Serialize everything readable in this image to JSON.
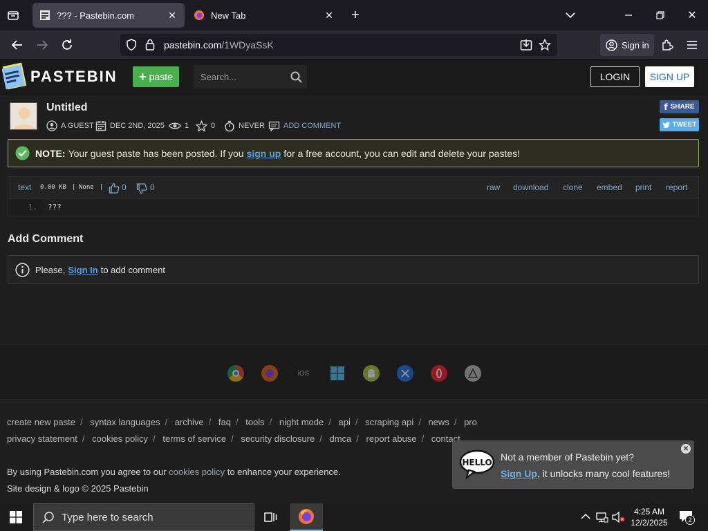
{
  "browser": {
    "tabs": [
      {
        "title": "??? - Pastebin.com",
        "active": true
      },
      {
        "title": "New Tab",
        "active": false
      }
    ],
    "url_domain": "pastebin.com",
    "url_path": "/1WDyaSsK",
    "signin_label": "Sign in"
  },
  "header": {
    "logo_text": "PASTEBIN",
    "paste_label": "paste",
    "search_placeholder": "Search...",
    "login_label": "LOGIN",
    "signup_label": "SIGN UP"
  },
  "paste": {
    "title": "Untitled",
    "author": "A GUEST",
    "date": "DEC 2ND, 2025",
    "views": "1",
    "stars": "0",
    "expires": "NEVER",
    "add_comment": "ADD COMMENT",
    "share_label": "SHARE",
    "tweet_label": "TWEET"
  },
  "notice": {
    "label": "NOTE:",
    "text_before": "Your guest paste has been posted. If you",
    "link": "sign up",
    "text_after": "for a free account, you can edit and delete your pastes!"
  },
  "code": {
    "syntax": "text",
    "size": "0.00 KB",
    "category": "None",
    "likes": "0",
    "dislikes": "0",
    "actions": [
      "raw",
      "download",
      "clone",
      "embed",
      "print",
      "report"
    ],
    "line_number": "1.",
    "line_text": "???"
  },
  "comments": {
    "title": "Add Comment",
    "text_before": "Please,",
    "link": "Sign In",
    "text_after": "to add comment"
  },
  "apps": {
    "ios_label": "iOS"
  },
  "footer": {
    "links_row1": [
      "create new paste",
      "syntax languages",
      "archive",
      "faq",
      "tools",
      "night mode",
      "api",
      "scraping api",
      "news",
      "pro"
    ],
    "links_row2": [
      "privacy statement",
      "cookies policy",
      "terms of service",
      "security disclosure",
      "dmca",
      "report abuse",
      "contact"
    ],
    "cookie_before": "By using Pastebin.com you agree to our",
    "cookie_link": "cookies policy",
    "cookie_after": "to enhance your experience.",
    "copyright": "Site design & logo © 2025 Pastebin"
  },
  "promo": {
    "line1": "Not a member of Pastebin yet?",
    "link": "Sign Up",
    "line2_after": ", it unlocks many cool features!",
    "bubble_text": "HELLO"
  },
  "taskbar": {
    "search_placeholder": "Type here to search",
    "time": "4:25 AM",
    "date": "12/2/2025",
    "notification_count": "2"
  }
}
